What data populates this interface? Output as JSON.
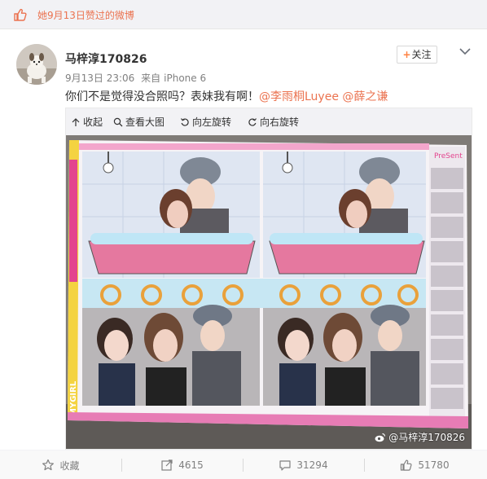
{
  "liked_bar": {
    "text": "她9月13日赞过的微博"
  },
  "post": {
    "username": "马梓淳170826",
    "time": "9月13日 23:06",
    "source_prefix": "来自",
    "source": "iPhone 6",
    "text": "你们不是觉得没合照吗？表妹我有啊！",
    "mention_1": "@李雨桐Luyee",
    "mention_2": "@薛之谦",
    "follow_label": "关注",
    "follow_plus": "+"
  },
  "media_tools": {
    "collapse": "收起",
    "view_large": "查看大图",
    "rotate_left": "向左旋转",
    "rotate_right": "向右旋转"
  },
  "photo": {
    "strip_label": "PreSent",
    "brand_label": "MYGIRL",
    "watermark": "@马梓淳170826"
  },
  "actions": {
    "favorite": "收藏",
    "repost_count": "4615",
    "comment_count": "31294",
    "like_count": "51780"
  },
  "colors": {
    "accent": "#eb7350",
    "follow_plus": "#ff8140",
    "text_gray": "#808080"
  }
}
